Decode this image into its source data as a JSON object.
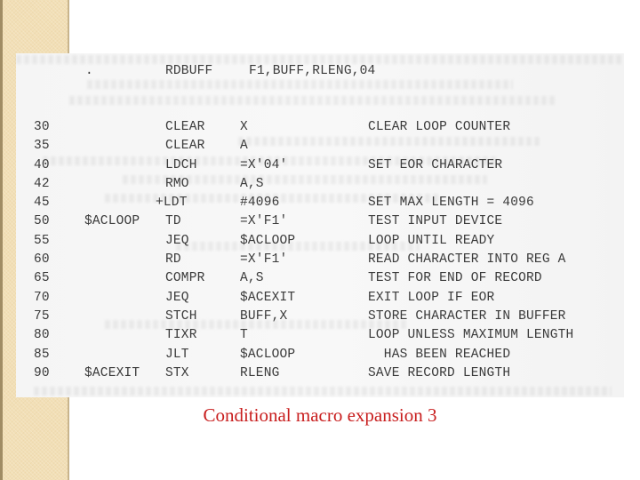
{
  "slide": {
    "caption": "Conditional macro expansion 3",
    "caption_color": "#c81e1e",
    "accent_bar_color": "#f2dfb6"
  },
  "listing": {
    "header": {
      "marker": ".",
      "opcode": "RDBUFF",
      "operands": "F1,BUFF,RLENG,04"
    },
    "lines": [
      {
        "num": "30",
        "label": "",
        "op": "CLEAR",
        "operand": "X",
        "comment": "CLEAR LOOP COUNTER"
      },
      {
        "num": "35",
        "label": "",
        "op": "CLEAR",
        "operand": "A",
        "comment": ""
      },
      {
        "num": "40",
        "label": "",
        "op": "LDCH",
        "operand": "=X'04'",
        "comment": "SET EOR CHARACTER"
      },
      {
        "num": "42",
        "label": "",
        "op": "RMO",
        "operand": "A,S",
        "comment": ""
      },
      {
        "num": "45",
        "label": "",
        "op": "+LDT",
        "operand": "#4096",
        "comment": "SET MAX LENGTH = 4096"
      },
      {
        "num": "50",
        "label": "$ACLOOP",
        "op": "TD",
        "operand": "=X'F1'",
        "comment": "TEST INPUT DEVICE"
      },
      {
        "num": "55",
        "label": "",
        "op": "JEQ",
        "operand": "$ACLOOP",
        "comment": "LOOP UNTIL READY"
      },
      {
        "num": "60",
        "label": "",
        "op": "RD",
        "operand": "=X'F1'",
        "comment": "READ CHARACTER INTO REG A"
      },
      {
        "num": "65",
        "label": "",
        "op": "COMPR",
        "operand": "A,S",
        "comment": "TEST FOR END OF RECORD"
      },
      {
        "num": "70",
        "label": "",
        "op": "JEQ",
        "operand": "$ACEXIT",
        "comment": "EXIT LOOP IF EOR"
      },
      {
        "num": "75",
        "label": "",
        "op": "STCH",
        "operand": "BUFF,X",
        "comment": "STORE CHARACTER IN BUFFER"
      },
      {
        "num": "80",
        "label": "",
        "op": "TIXR",
        "operand": "T",
        "comment": "LOOP UNLESS MAXIMUM LENGTH"
      },
      {
        "num": "85",
        "label": "",
        "op": "JLT",
        "operand": "$ACLOOP",
        "comment": "  HAS BEEN REACHED"
      },
      {
        "num": "90",
        "label": "$ACEXIT",
        "op": "STX",
        "operand": "RLENG",
        "comment": "SAVE RECORD LENGTH"
      }
    ]
  }
}
